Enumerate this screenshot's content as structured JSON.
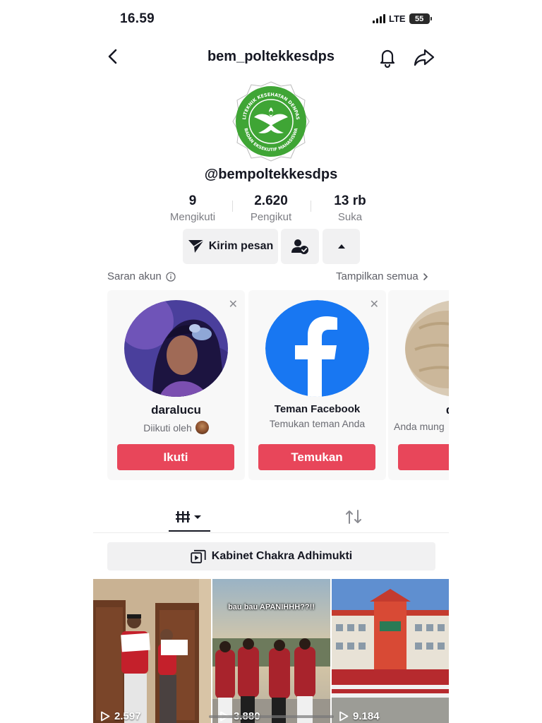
{
  "status_bar": {
    "time": "16.59",
    "network": "LTE",
    "battery": "55"
  },
  "header": {
    "title": "bem_poltekkesdps"
  },
  "profile": {
    "logo_ring_text": "POLITEKNIK KESEHATAN DENPASAR · BADAN EKSEKUTIF MAHASISWA",
    "handle": "@bempoltekkesdps",
    "stats": [
      {
        "value": "9",
        "label": "Mengikuti"
      },
      {
        "value": "2.620",
        "label": "Pengikut"
      },
      {
        "value": "13 rb",
        "label": "Suka"
      }
    ],
    "message_label": "Kirim pesan"
  },
  "suggestions": {
    "title": "Saran akun",
    "show_all": "Tampilkan semua",
    "cards": [
      {
        "name": "daralucu",
        "sub": "Diikuti oleh",
        "button": "Ikuti"
      },
      {
        "name": "Teman Facebook",
        "sub": "Temukan teman Anda",
        "button": "Temukan"
      },
      {
        "name": "diar",
        "sub": "Anda mung",
        "button": "I"
      }
    ]
  },
  "playlist": {
    "label": "Kabinet Chakra Adhimukti"
  },
  "videos": [
    {
      "views": "2.597"
    },
    {
      "views": "3.880",
      "caption": "bau bau APANIHHH??!!"
    },
    {
      "views": "9.184"
    }
  ],
  "colors": {
    "accent": "#E8465A",
    "facebook": "#1877F2",
    "logo_green": "#3FA535"
  }
}
